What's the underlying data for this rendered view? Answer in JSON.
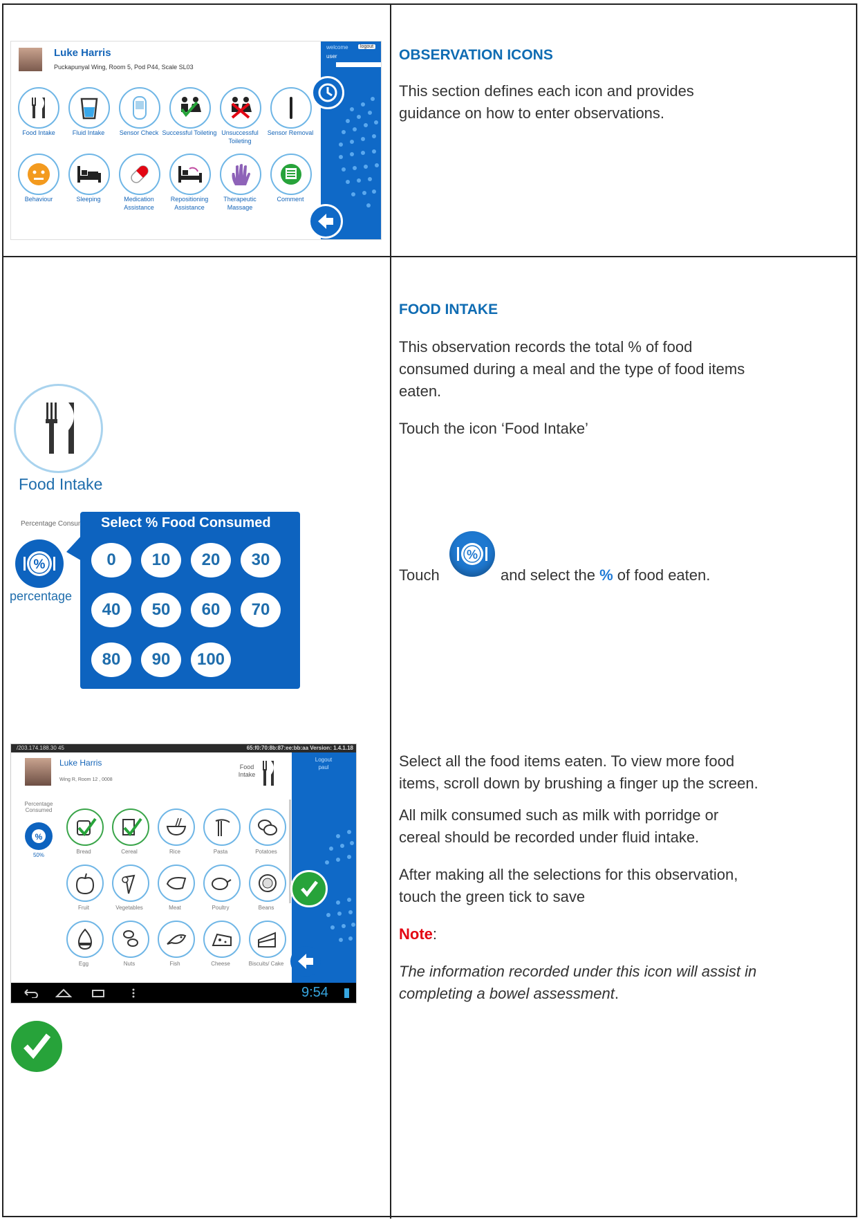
{
  "section1": {
    "heading": "OBSERVATION ICONS",
    "body": "This section defines each icon and provides guidance on how to enter observations."
  },
  "screen1": {
    "patient_name": "Luke Harris",
    "location": "Puckapunyal Wing, Room 5, Pod P44, Scale SL03",
    "welcome": "welcome",
    "user": "user",
    "logout": "logout",
    "icons": [
      {
        "label": "Food Intake",
        "icon": "fork-knife-icon"
      },
      {
        "label": "Fluid Intake",
        "icon": "cup-icon"
      },
      {
        "label": "Sensor Check",
        "icon": "sensor-icon"
      },
      {
        "label": "Successful Toileting",
        "icon": "toilet-success-icon"
      },
      {
        "label": "Unsuccessful Toileting",
        "icon": "toilet-fail-icon"
      },
      {
        "label": "Sensor Removal",
        "icon": "sensor-removal-icon"
      },
      {
        "label": "Behaviour",
        "icon": "face-icon"
      },
      {
        "label": "Sleeping",
        "icon": "bed-icon"
      },
      {
        "label": "Medication Assistance",
        "icon": "pill-icon"
      },
      {
        "label": "Repositioning Assistance",
        "icon": "reposition-icon"
      },
      {
        "label": "Therapeutic Massage",
        "icon": "hand-icon"
      },
      {
        "label": "Comment",
        "icon": "comment-icon"
      }
    ]
  },
  "section2": {
    "heading": "FOOD INTAKE",
    "intro": "This observation records the total % of food consumed during a meal and the type of food items eaten.",
    "touch_icon": "Touch the icon ‘Food Intake’",
    "touch_pre": "Touch",
    "touch_mid": "and select the",
    "touch_pct": "%",
    "touch_post": "of food eaten.",
    "select_items": "Select all the food items eaten. To view more food items, scroll down by brushing a finger up the screen.",
    "milk": "All milk consumed such as milk with porridge or cereal should be recorded under fluid intake.",
    "after": "After making all the selections for this observation, touch the green tick to save",
    "note_label": "Note",
    "note_colon": ":",
    "note_text": "The information recorded under this icon will assist in completing a bowel assessment",
    "note_end": "."
  },
  "food_icon_large": {
    "label": "Food Intake"
  },
  "percent_picker": {
    "side_label": "Percentage Consumed",
    "side_text": "percentage",
    "title": "Select % Food Consumed",
    "options": [
      "0",
      "10",
      "20",
      "30",
      "40",
      "50",
      "60",
      "70",
      "80",
      "90",
      "100"
    ]
  },
  "screen2": {
    "status_left": "/203.174.188.30 45",
    "status_right": "65:f0:70:8b:87:ee:bb:aa   Version: 1.4.1.18",
    "patient_name": "Luke Harris",
    "location": "Wing R, Room 12 , 0008",
    "header_label": "Food Intake",
    "logout": "Logout",
    "user": "paul",
    "pct_label": "Percentage Consumed",
    "pct_value": "50%",
    "time": "9:54",
    "foods": [
      "Bread",
      "Cereal",
      "Rice",
      "Pasta",
      "Potatoes",
      "Fruit",
      "Vegetables",
      "Meat",
      "Poultry",
      "Beans",
      "Egg",
      "Nuts",
      "Fish",
      "Cheese",
      "Biscuits/ Cake"
    ],
    "selected": [
      "Bread",
      "Cereal"
    ]
  },
  "colors": {
    "brand_blue": "#0f69c7",
    "heading_blue": "#0f6cb3",
    "tick_green": "#27a33a",
    "note_red": "#e30613"
  }
}
